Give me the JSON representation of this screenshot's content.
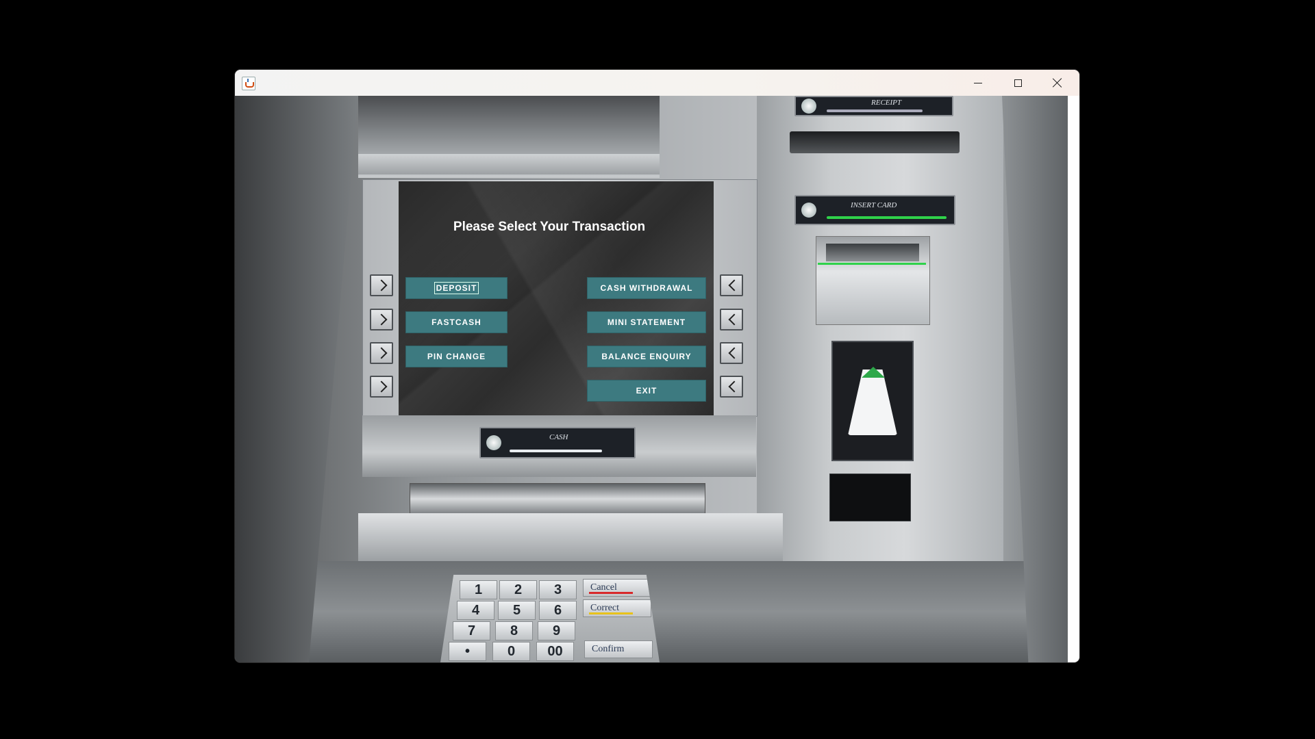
{
  "window": {
    "title": "",
    "controls": [
      "minimize-icon",
      "maximize-icon",
      "close-icon"
    ]
  },
  "screen": {
    "title": "Please Select Your Transaction",
    "left_buttons": [
      {
        "id": "deposit",
        "label": "DEPOSIT",
        "focused": true
      },
      {
        "id": "fastcash",
        "label": "FASTCASH"
      },
      {
        "id": "pin-change",
        "label": "PIN CHANGE"
      }
    ],
    "right_buttons": [
      {
        "id": "cash-withdrawal",
        "label": "CASH WITHDRAWAL"
      },
      {
        "id": "mini-statement",
        "label": "MINI STATEMENT"
      },
      {
        "id": "balance-enquiry",
        "label": "BALANCE ENQUIRY"
      },
      {
        "id": "exit",
        "label": "EXIT"
      }
    ],
    "button_color": "#3d7a80"
  },
  "machine": {
    "receipt_label": "RECEIPT",
    "card_label": "INSERT CARD",
    "cash_label": "CASH",
    "card_accent": "#2fd24a",
    "keypad": {
      "keys": [
        "1",
        "2",
        "3",
        "4",
        "5",
        "6",
        "7",
        "8",
        "9",
        "•",
        "0",
        "00"
      ],
      "function_keys": [
        {
          "label": "Cancel",
          "stripe": "#d8282a"
        },
        {
          "label": "Correct",
          "stripe": "#e8c21a"
        },
        {
          "label": "Confirm",
          "stripe": ""
        }
      ]
    }
  }
}
